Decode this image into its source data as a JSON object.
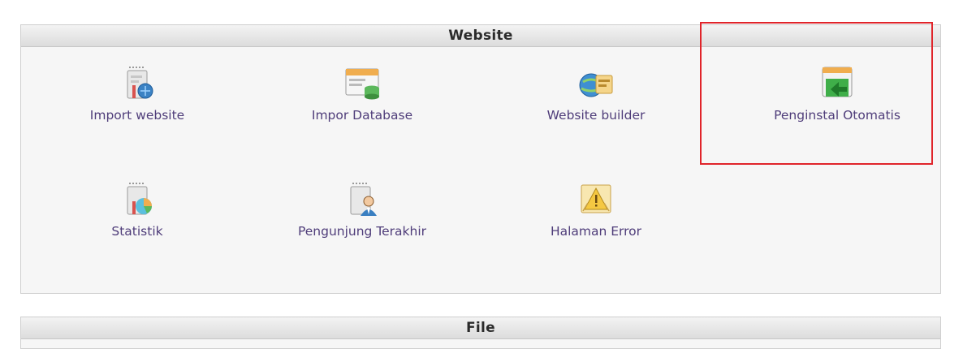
{
  "website_section": {
    "title": "Website",
    "items": [
      {
        "label": "Import website",
        "icon": "import-website-icon"
      },
      {
        "label": "Impor Database",
        "icon": "database-import-icon"
      },
      {
        "label": "Website builder",
        "icon": "website-builder-icon"
      },
      {
        "label": "Penginstal Otomatis",
        "icon": "auto-installer-icon"
      },
      {
        "label": "Statistik",
        "icon": "statistics-icon"
      },
      {
        "label": "Pengunjung Terakhir",
        "icon": "recent-visitors-icon"
      },
      {
        "label": "Halaman Error",
        "icon": "error-pages-icon"
      }
    ]
  },
  "file_section": {
    "title": "File"
  },
  "colors": {
    "label": "#4f3d7a",
    "highlight": "#e0242a"
  }
}
